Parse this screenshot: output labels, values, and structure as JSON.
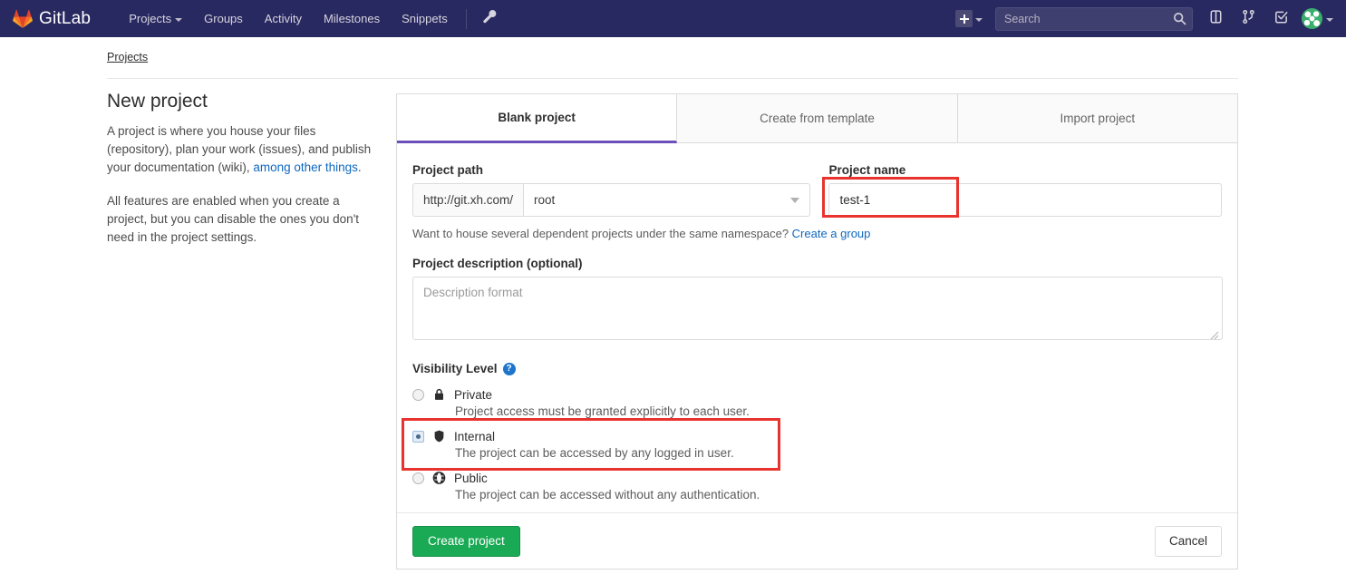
{
  "navbar": {
    "brand": "GitLab",
    "brand_icon": "gitlab-fox-logo",
    "links": [
      {
        "label": "Projects",
        "has_caret": true
      },
      {
        "label": "Groups",
        "has_caret": false
      },
      {
        "label": "Activity",
        "has_caret": false
      },
      {
        "label": "Milestones",
        "has_caret": false
      },
      {
        "label": "Snippets",
        "has_caret": false
      }
    ],
    "admin_icon": "wrench-icon",
    "new_icon": "plus-square-icon",
    "search": {
      "placeholder": "Search",
      "value": ""
    },
    "search_icon": "search-icon",
    "icons": [
      {
        "name": "issues-icon"
      },
      {
        "name": "merge-requests-icon"
      },
      {
        "name": "todos-checkmark-icon"
      }
    ],
    "avatar_icon": "user-avatar",
    "bg_color": "#292961"
  },
  "breadcrumb": {
    "text": "Projects"
  },
  "sidebar": {
    "title": "New project",
    "paragraph1_part1": "A project is where you house your files (repository), plan your work (issues), and publish your documentation (wiki), ",
    "paragraph1_link": "among other things",
    "paragraph1_part2": ".",
    "paragraph2": "All features are enabled when you create a project, but you can disable the ones you don't need in the project settings."
  },
  "main": {
    "tabs": [
      {
        "label": "Blank project",
        "active": true
      },
      {
        "label": "Create from template",
        "active": false
      },
      {
        "label": "Import project",
        "active": false
      }
    ],
    "project_path": {
      "label": "Project path",
      "prefix": "http://git.xh.com/",
      "namespace_value": "root"
    },
    "project_name": {
      "label": "Project name",
      "value": "test-1",
      "placeholder": ""
    },
    "namespace_hint": {
      "text": "Want to house several dependent projects under the same namespace? ",
      "link": "Create a group"
    },
    "description": {
      "label": "Project description (optional)",
      "placeholder": "Description format",
      "value": ""
    },
    "visibility": {
      "label": "Visibility Level",
      "help_icon": "help-question-icon",
      "options": [
        {
          "id": "private",
          "name": "Private",
          "icon": "lock-icon",
          "description": "Project access must be granted explicitly to each user.",
          "selected": false
        },
        {
          "id": "internal",
          "name": "Internal",
          "icon": "shield-icon",
          "description": "The project can be accessed by any logged in user.",
          "selected": true
        },
        {
          "id": "public",
          "name": "Public",
          "icon": "globe-icon",
          "description": "The project can be accessed without any authentication.",
          "selected": false
        }
      ]
    },
    "actions": {
      "submit_label": "Create project",
      "cancel_label": "Cancel"
    }
  },
  "annotations": {
    "color": "#e8332e",
    "boxes": [
      {
        "id": "anno-name",
        "target": "project-name-input"
      },
      {
        "id": "anno-internal",
        "target": "visibility-option-internal"
      }
    ]
  },
  "colors": {
    "nav_bg": "#292961",
    "accent_purple": "#6b4fbb",
    "link_blue": "#1068bf",
    "success_green": "#1aaa55",
    "annotation_red": "#e8332e"
  }
}
